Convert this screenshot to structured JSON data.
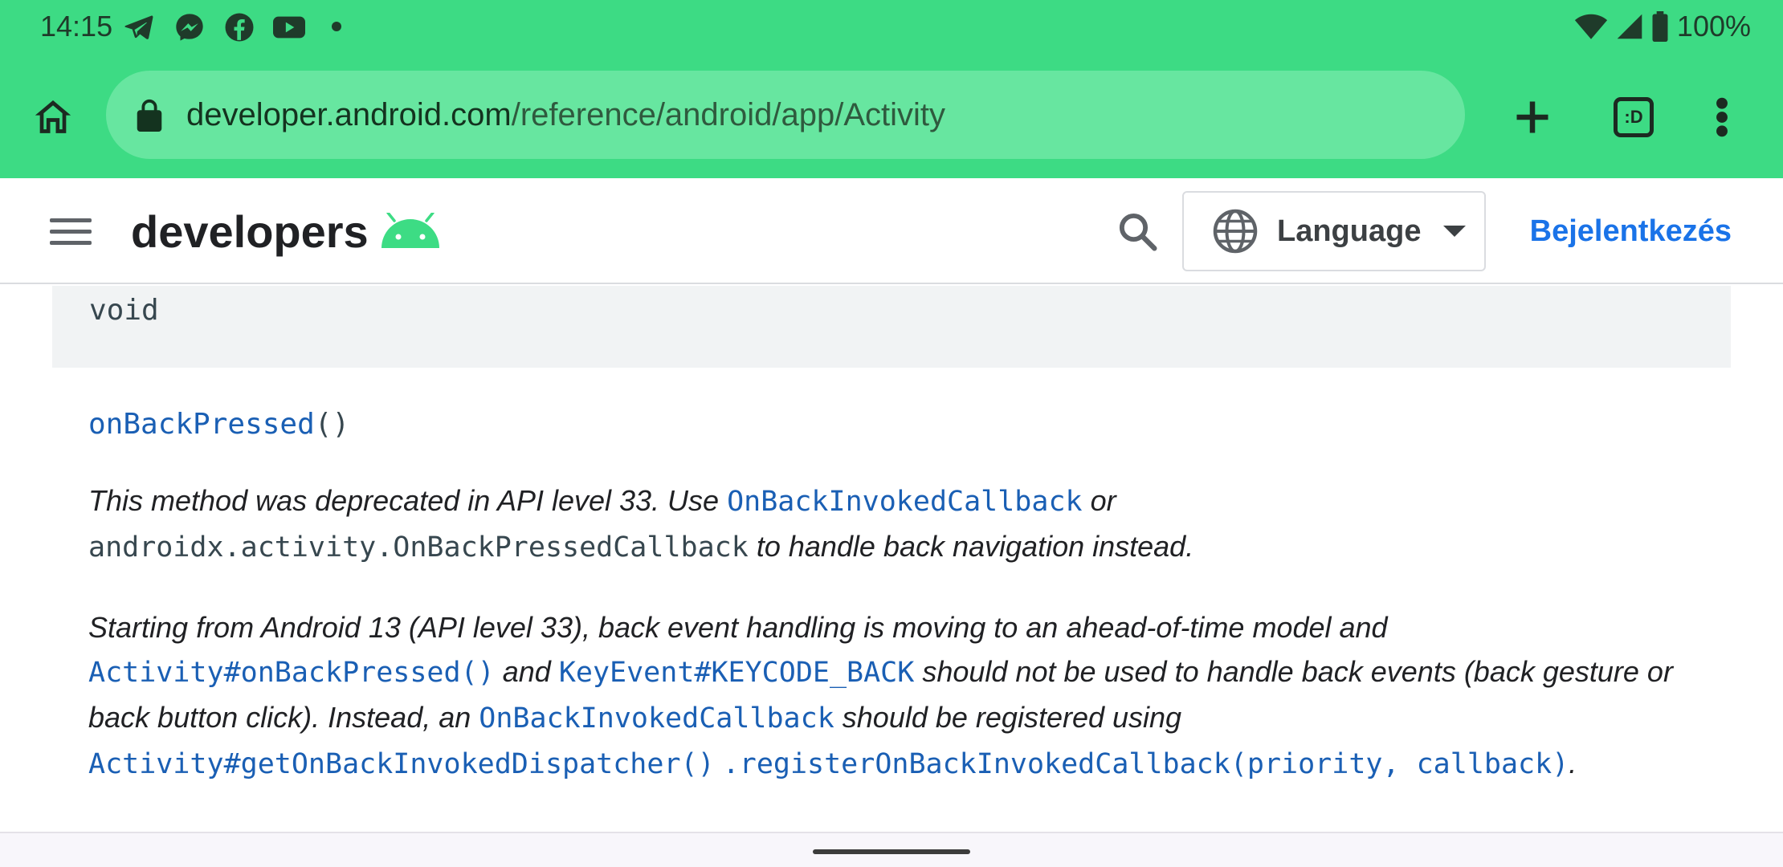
{
  "status_bar": {
    "time": "14:15",
    "notification_icons": [
      "telegram-icon",
      "messenger-icon",
      "facebook-icon",
      "youtube-icon"
    ],
    "battery": "100%"
  },
  "browser": {
    "url_domain": "developer.android.com",
    "url_path": "/reference/android/app/Activity",
    "tab_count_label": ":D"
  },
  "site_header": {
    "brand": "developers",
    "language_label": "Language",
    "signin_label": "Bejelentkezés"
  },
  "content": {
    "return_type": "void",
    "method_name": "onBackPressed",
    "method_parens": "()",
    "p1": {
      "t1": "This method was deprecated in API level 33. Use ",
      "l1": "OnBackInvokedCallback",
      "t2": " or ",
      "c1": "androidx.activity.OnBackPressedCallback",
      "t3": " to handle back navigation instead."
    },
    "p2": {
      "t1": "Starting from Android 13 (API level 33), back event handling is moving to an ahead-of-time model and ",
      "l1": "Activity#onBackPressed()",
      "t2": " and ",
      "l2": "KeyEvent#KEYCODE_BACK",
      "t3": " should not be used to handle back events (back gesture or back button click). Instead, an ",
      "l3": "OnBackInvokedCallback",
      "t4": " should be registered using ",
      "l4": "Activity#getOnBackInvokedDispatcher()",
      "l5": ".registerOnBackInvokedCallback(priority, callback)",
      "t5": "."
    }
  },
  "colors": {
    "chrome_green": "#3ddb84",
    "link_blue": "#1a5fb4",
    "signin_blue": "#1a73e8",
    "android_green": "#3ddc84"
  }
}
